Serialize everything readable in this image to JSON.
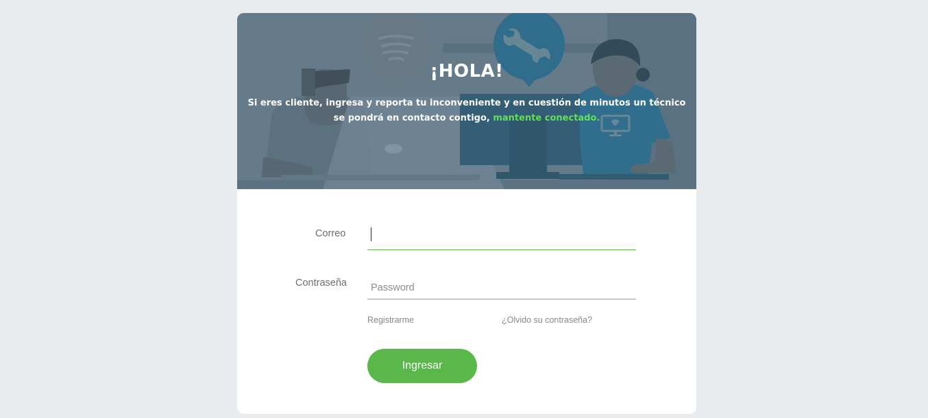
{
  "banner": {
    "title": "¡HOLA!",
    "text_main": "Si eres cliente, ingresa y reporta tu inconveniente y en cuestión de minutos un técnico se pondrá en contacto contigo, ",
    "text_accent": "mantente conectado.",
    "colors": {
      "background": "#687e8c",
      "accent": "#61e15a",
      "bubble_blue": "#2a6f93"
    },
    "icons": [
      "tornado-icon",
      "wrench-icon",
      "monitor-heart-icon"
    ]
  },
  "form": {
    "email": {
      "label": "Correo",
      "value": "",
      "placeholder": ""
    },
    "password": {
      "label": "Contraseña",
      "value": "",
      "placeholder": "Password"
    },
    "links": {
      "register": "Registrarme",
      "forgot": "¿Olvido su contraseña?"
    },
    "submit_label": "Ingresar",
    "colors": {
      "primary": "#5ab84a",
      "active_underline": "#5cb84a"
    }
  }
}
